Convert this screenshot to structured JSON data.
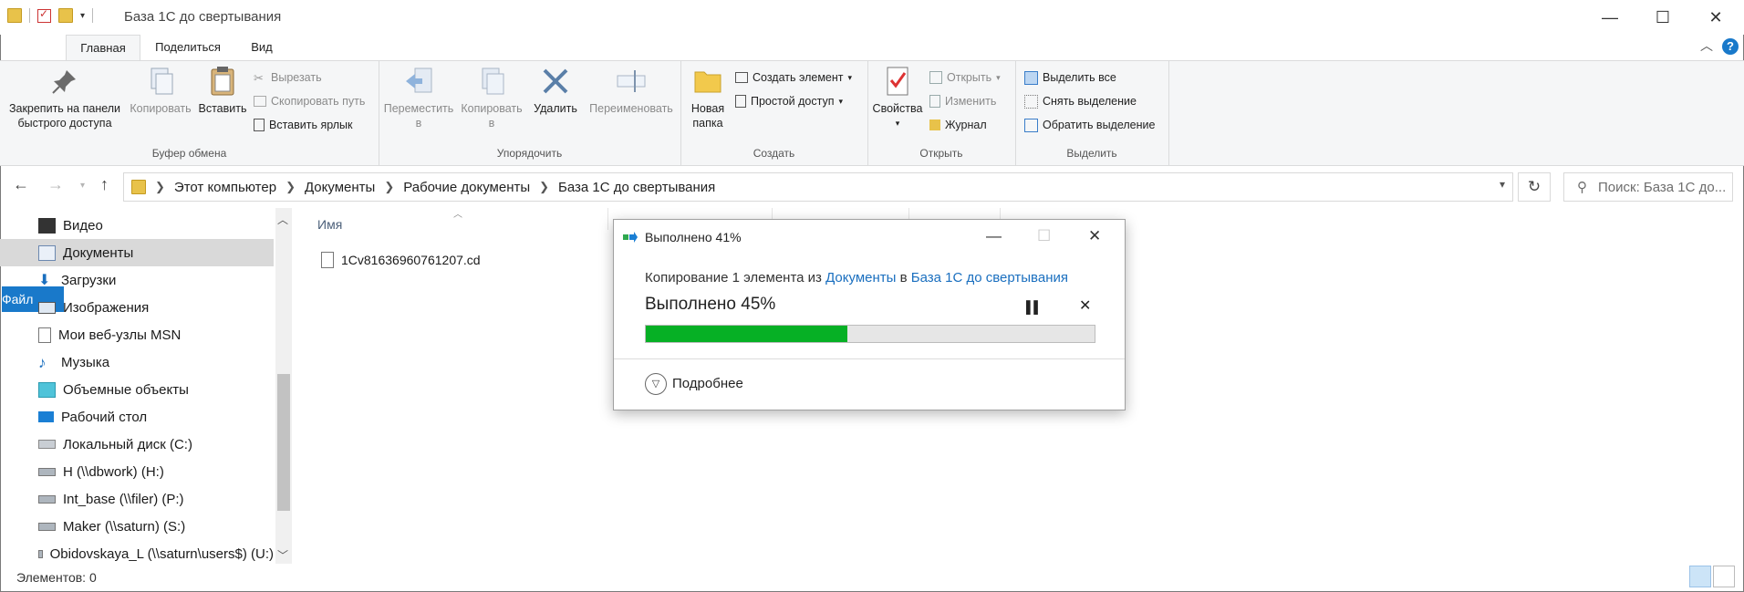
{
  "window": {
    "title": "База 1С до свертывания",
    "minimize_icon": "minimize-icon",
    "maximize_icon": "maximize-icon",
    "close_icon": "close-icon"
  },
  "ribbon_tabs": [
    "Файл",
    "Главная",
    "Поделиться",
    "Вид"
  ],
  "ribbon": {
    "clipboard": {
      "label": "Буфер обмена",
      "pin": "Закрепить на панели быстрого доступа",
      "pin_l1": "Закрепить на панели",
      "pin_l2": "быстрого доступа",
      "copy": "Копировать",
      "paste": "Вставить",
      "cut": "Вырезать",
      "copy_path": "Скопировать путь",
      "paste_shortcut": "Вставить ярлык"
    },
    "organize": {
      "label": "Упорядочить",
      "move_l1": "Переместить",
      "move_l2": "в",
      "copy_l1": "Копировать",
      "copy_l2": "в",
      "delete": "Удалить",
      "rename": "Переименовать"
    },
    "create": {
      "label": "Создать",
      "new_folder_l1": "Новая",
      "new_folder_l2": "папка",
      "new_item": "Создать элемент",
      "easy_access": "Простой доступ"
    },
    "open": {
      "label": "Открыть",
      "properties": "Свойства",
      "open": "Открыть",
      "edit": "Изменить",
      "history": "Журнал"
    },
    "select": {
      "label": "Выделить",
      "select_all": "Выделить все",
      "select_none": "Снять выделение",
      "invert": "Обратить выделение"
    }
  },
  "address": {
    "crumbs": [
      "Этот компьютер",
      "Документы",
      "Рабочие документы",
      "База 1С до свертывания"
    ],
    "search_placeholder": "Поиск: База 1С до..."
  },
  "nav_pane": {
    "items": [
      {
        "label": "Видео",
        "icon": "video-folder-icon"
      },
      {
        "label": "Документы",
        "icon": "documents-folder-icon",
        "selected": true
      },
      {
        "label": "Загрузки",
        "icon": "downloads-icon"
      },
      {
        "label": "Изображения",
        "icon": "pictures-icon"
      },
      {
        "label": "Мои веб-узлы MSN",
        "icon": "web-sites-icon"
      },
      {
        "label": "Музыка",
        "icon": "music-icon"
      },
      {
        "label": "Объемные объекты",
        "icon": "3d-objects-icon"
      },
      {
        "label": "Рабочий стол",
        "icon": "desktop-icon"
      },
      {
        "label": "Локальный диск (C:)",
        "icon": "local-disk-icon"
      },
      {
        "label": "H (\\\\dbwork) (H:)",
        "icon": "network-drive-icon"
      },
      {
        "label": "Int_base (\\\\filer) (P:)",
        "icon": "network-drive-icon"
      },
      {
        "label": "Maker (\\\\saturn) (S:)",
        "icon": "network-drive-icon"
      },
      {
        "label": "Obidovskaya_L (\\\\saturn\\users$) (U:)",
        "icon": "network-drive-icon"
      }
    ]
  },
  "content": {
    "column_name": "Имя",
    "files": [
      "1Cv81636960761207.cd"
    ]
  },
  "status": {
    "items_count": "Элементов: 0"
  },
  "dialog": {
    "title": "Выполнено 41%",
    "line_prefix": "Копирование 1 элемента из",
    "source": "Документы",
    "line_mid": "в",
    "destination": "База 1С до свертывания",
    "progress_text": "Выполнено 45%",
    "progress_value": 0.45,
    "more": "Подробнее"
  },
  "colors": {
    "accent": "#1979ca",
    "progress": "#06b025",
    "link": "#1a6fbf"
  }
}
